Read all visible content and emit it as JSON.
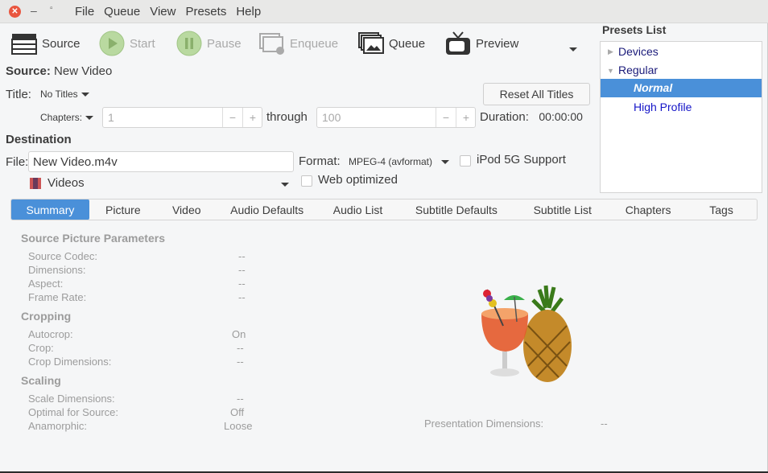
{
  "window": {
    "menu": [
      "File",
      "Queue",
      "View",
      "Presets",
      "Help"
    ]
  },
  "toolbar": {
    "source": "Source",
    "start": "Start",
    "pause": "Pause",
    "enqueue": "Enqueue",
    "queue": "Queue",
    "preview": "Preview"
  },
  "source": {
    "label": "Source:",
    "value": "New Video"
  },
  "title": {
    "label": "Title:",
    "value": "No Titles",
    "reset": "Reset All Titles"
  },
  "chapters": {
    "mode": "Chapters:",
    "from": "1",
    "through_label": "through",
    "to": "100",
    "duration_label": "Duration:",
    "duration": "00:00:00"
  },
  "destination": {
    "heading": "Destination",
    "file_label": "File:",
    "file": "New Video.m4v",
    "folder": "Videos",
    "format_label": "Format:",
    "format": "MPEG-4 (avformat)",
    "ipod": "iPod 5G Support",
    "web": "Web optimized"
  },
  "tabs": [
    "Summary",
    "Picture",
    "Video",
    "Audio Defaults",
    "Audio List",
    "Subtitle Defaults",
    "Subtitle List",
    "Chapters",
    "Tags"
  ],
  "summary": {
    "spp": "Source Picture Parameters",
    "rows1": [
      [
        "Source Codec:",
        "--"
      ],
      [
        "Dimensions:",
        "--"
      ],
      [
        "Aspect:",
        "--"
      ],
      [
        "Frame Rate:",
        "--"
      ]
    ],
    "cropping": "Cropping",
    "rows2": [
      [
        "Autocrop:",
        "On"
      ],
      [
        "Crop:",
        "--"
      ],
      [
        "Crop Dimensions:",
        "--"
      ]
    ],
    "scaling": "Scaling",
    "rows3": [
      [
        "Scale Dimensions:",
        "--"
      ],
      [
        "Optimal for Source:",
        "Off"
      ],
      [
        "Anamorphic:",
        "Loose"
      ]
    ],
    "presentation_label": "Presentation Dimensions:",
    "presentation": "--"
  },
  "presets": {
    "heading": "Presets List",
    "items": [
      "Devices",
      "Regular",
      "Normal",
      "High Profile"
    ],
    "selected": "Normal",
    "accent": "#4a90d9"
  }
}
